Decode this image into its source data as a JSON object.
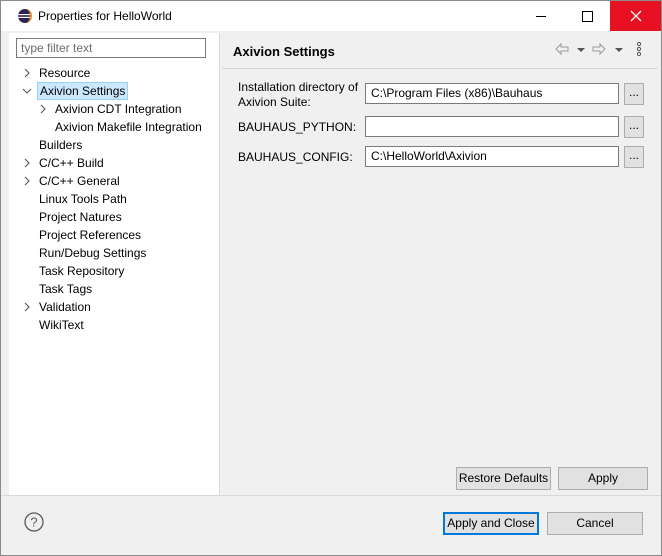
{
  "window": {
    "title": "Properties for HelloWorld",
    "icon": "eclipse-icon",
    "controls": [
      "minimize-icon",
      "maximize-icon",
      "close-icon"
    ],
    "close_color": "#e81123"
  },
  "sidebar": {
    "filter_placeholder": "type filter text",
    "items": [
      {
        "label": "Resource",
        "expandable": true,
        "expanded": false
      },
      {
        "label": "Axivion Settings",
        "expandable": true,
        "expanded": true,
        "selected": true
      },
      {
        "label": "Axivion CDT Integration",
        "expandable": true,
        "expanded": false
      },
      {
        "label": "Axivion Makefile Integration",
        "expandable": false
      },
      {
        "label": "Builders",
        "expandable": false
      },
      {
        "label": "C/C++ Build",
        "expandable": true,
        "expanded": false
      },
      {
        "label": "C/C++ General",
        "expandable": true,
        "expanded": false
      },
      {
        "label": "Linux Tools Path",
        "expandable": false
      },
      {
        "label": "Project Natures",
        "expandable": false
      },
      {
        "label": "Project References",
        "expandable": false
      },
      {
        "label": "Run/Debug Settings",
        "expandable": false
      },
      {
        "label": "Task Repository",
        "expandable": false
      },
      {
        "label": "Task Tags",
        "expandable": false
      },
      {
        "label": "Validation",
        "expandable": true,
        "expanded": false
      },
      {
        "label": "WikiText",
        "expandable": false
      }
    ],
    "selection_color": "#cce8ff"
  },
  "main": {
    "title": "Axivion Settings",
    "nav_icons": [
      "back-arrow-icon",
      "back-menu-icon",
      "forward-arrow-icon",
      "forward-menu-icon",
      "view-menu-icon"
    ],
    "fields": [
      {
        "label_line1": "Installation directory of",
        "label_line2": "Axivion Suite:",
        "value": "C:\\Program Files (x86)\\Bauhaus",
        "browse": "..."
      },
      {
        "label": "BAUHAUS_PYTHON:",
        "value": "",
        "browse": "..."
      },
      {
        "label": "BAUHAUS_CONFIG:",
        "value": "C:\\HelloWorld\\Axivion",
        "browse": "..."
      }
    ],
    "restore_defaults_label": "Restore Defaults",
    "apply_label": "Apply"
  },
  "footer": {
    "help_icon": "help-icon",
    "apply_close_label": "Apply and Close",
    "cancel_label": "Cancel",
    "default_button_color": "#0078d7"
  }
}
